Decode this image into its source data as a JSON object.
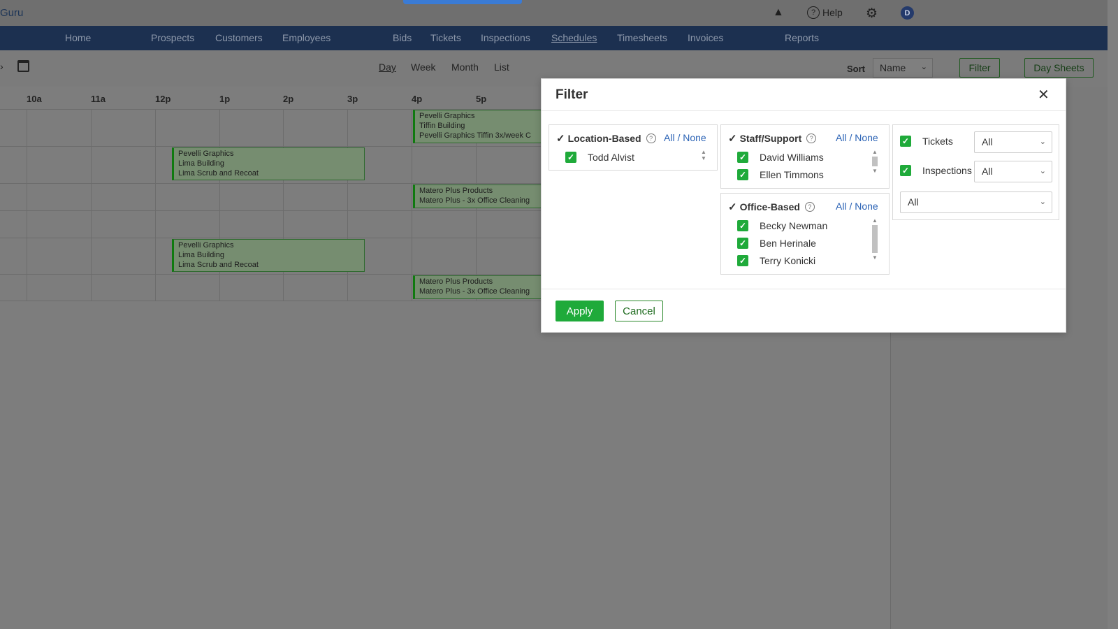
{
  "app": {
    "logo": "Guru",
    "help_label": "Help",
    "avatar_initial": "D"
  },
  "nav": {
    "items": [
      {
        "label": "Home"
      },
      {
        "label": "Prospects"
      },
      {
        "label": "Customers"
      },
      {
        "label": "Employees"
      },
      {
        "label": "Bids"
      },
      {
        "label": "Tickets"
      },
      {
        "label": "Inspections"
      },
      {
        "label": "Schedules",
        "active": true
      },
      {
        "label": "Timesheets"
      },
      {
        "label": "Invoices"
      },
      {
        "label": "Reports"
      }
    ]
  },
  "toolbar": {
    "views": [
      {
        "label": "Day",
        "active": true
      },
      {
        "label": "Week"
      },
      {
        "label": "Month"
      },
      {
        "label": "List"
      }
    ],
    "sort_label": "Sort",
    "sort_value": "Name",
    "filter_label": "Filter",
    "day_sheets_label": "Day Sheets"
  },
  "calendar": {
    "hours": [
      "10a",
      "11a",
      "12p",
      "1p",
      "2p",
      "3p",
      "4p",
      "5p"
    ],
    "events": [
      {
        "lines": [
          "Pevelli Graphics",
          "Tiffin Building",
          "Pevelli Graphics Tiffin 3x/week C"
        ]
      },
      {
        "lines": [
          "Pevelli Graphics",
          "Lima Building",
          "Lima Scrub and Recoat"
        ]
      },
      {
        "lines": [
          "Matero Plus Products",
          "Matero Plus - 3x Office Cleaning"
        ]
      },
      {
        "lines": [
          "Pevelli Graphics",
          "Lima Building",
          "Lima Scrub and Recoat"
        ]
      },
      {
        "lines": [
          "Matero Plus Products",
          "Matero Plus - 3x Office Cleaning"
        ]
      }
    ]
  },
  "filter_modal": {
    "title": "Filter",
    "all_label": "All",
    "separator": "/",
    "none_label": "None",
    "location_based": {
      "title": "Location-Based",
      "people": [
        "Todd Alvist"
      ]
    },
    "staff_support": {
      "title": "Staff/Support",
      "people": [
        "David Williams",
        "Ellen Timmons"
      ]
    },
    "office_based": {
      "title": "Office-Based",
      "people": [
        "Becky Newman",
        "Ben Herinale",
        "Terry Konicki"
      ]
    },
    "tickets": {
      "label": "Tickets",
      "value": "All"
    },
    "inspections": {
      "label": "Inspections",
      "value": "All"
    },
    "third_select": {
      "value": "All"
    },
    "apply_label": "Apply",
    "cancel_label": "Cancel"
  }
}
